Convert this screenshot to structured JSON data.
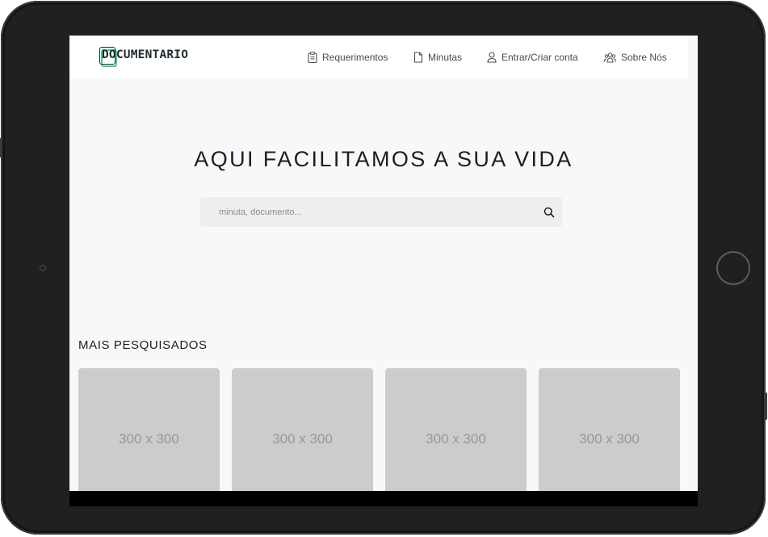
{
  "brand": {
    "name": "DOCUMENTARIO",
    "colors": {
      "accent_green": "#3ecf8e",
      "accent_blue": "#3a8fd6",
      "text": "#1e2a30"
    }
  },
  "nav": {
    "items": [
      {
        "label": "Requerimentos",
        "icon": "clipboard-icon"
      },
      {
        "label": "Minutas",
        "icon": "file-icon"
      },
      {
        "label": "Entrar/Criar conta",
        "icon": "user-icon"
      },
      {
        "label": "Sobre Nós",
        "icon": "users-icon"
      }
    ]
  },
  "hero": {
    "title": "AQUI FACILITAMOS A SUA VIDA",
    "search": {
      "placeholder": "minuta, documento...",
      "value": "",
      "icon": "search-icon"
    }
  },
  "most_searched": {
    "title": "MAIS PESQUISADOS",
    "cards": [
      {
        "label": "300 x 300"
      },
      {
        "label": "300 x 300"
      },
      {
        "label": "300 x 300"
      },
      {
        "label": "300 x 300"
      }
    ]
  }
}
